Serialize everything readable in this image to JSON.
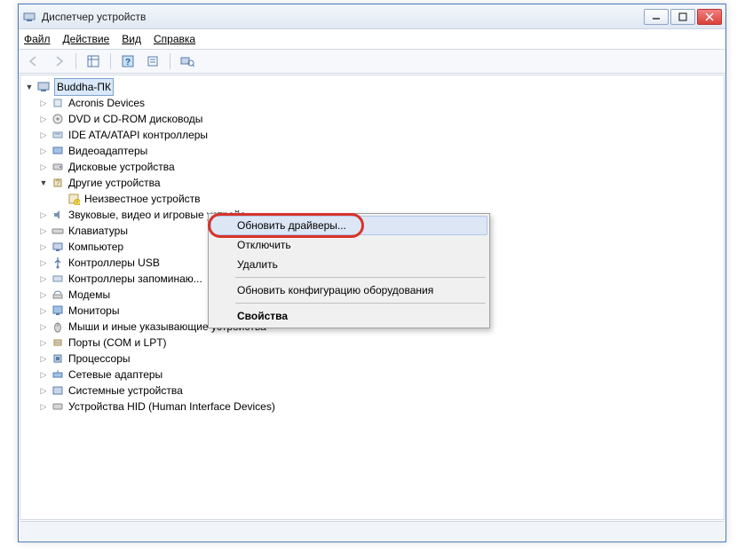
{
  "window": {
    "title": "Диспетчер устройств"
  },
  "menu": {
    "file": "Файл",
    "action": "Действие",
    "view": "Вид",
    "help": "Справка"
  },
  "tree": {
    "root": "Buddha-ПК",
    "nodes": [
      "Acronis Devices",
      "DVD и CD-ROM дисководы",
      "IDE ATA/ATAPI контроллеры",
      "Видеоадаптеры",
      "Дисковые устройства",
      "Другие устройства",
      "Звуковые, видео и игровые устройс...",
      "Клавиатуры",
      "Компьютер",
      "Контроллеры USB",
      "Контроллеры запоминаю...",
      "Модемы",
      "Мониторы",
      "Мыши и иные указывающие устройства",
      "Порты (COM и LPT)",
      "Процессоры",
      "Сетевые адаптеры",
      "Системные устройства",
      "Устройства HID (Human Interface Devices)"
    ],
    "unknown_device": "Неизвестное устройств"
  },
  "context_menu": {
    "update_drivers": "Обновить драйверы...",
    "disable": "Отключить",
    "delete": "Удалить",
    "refresh_config": "Обновить конфигурацию оборудования",
    "properties": "Свойства"
  }
}
